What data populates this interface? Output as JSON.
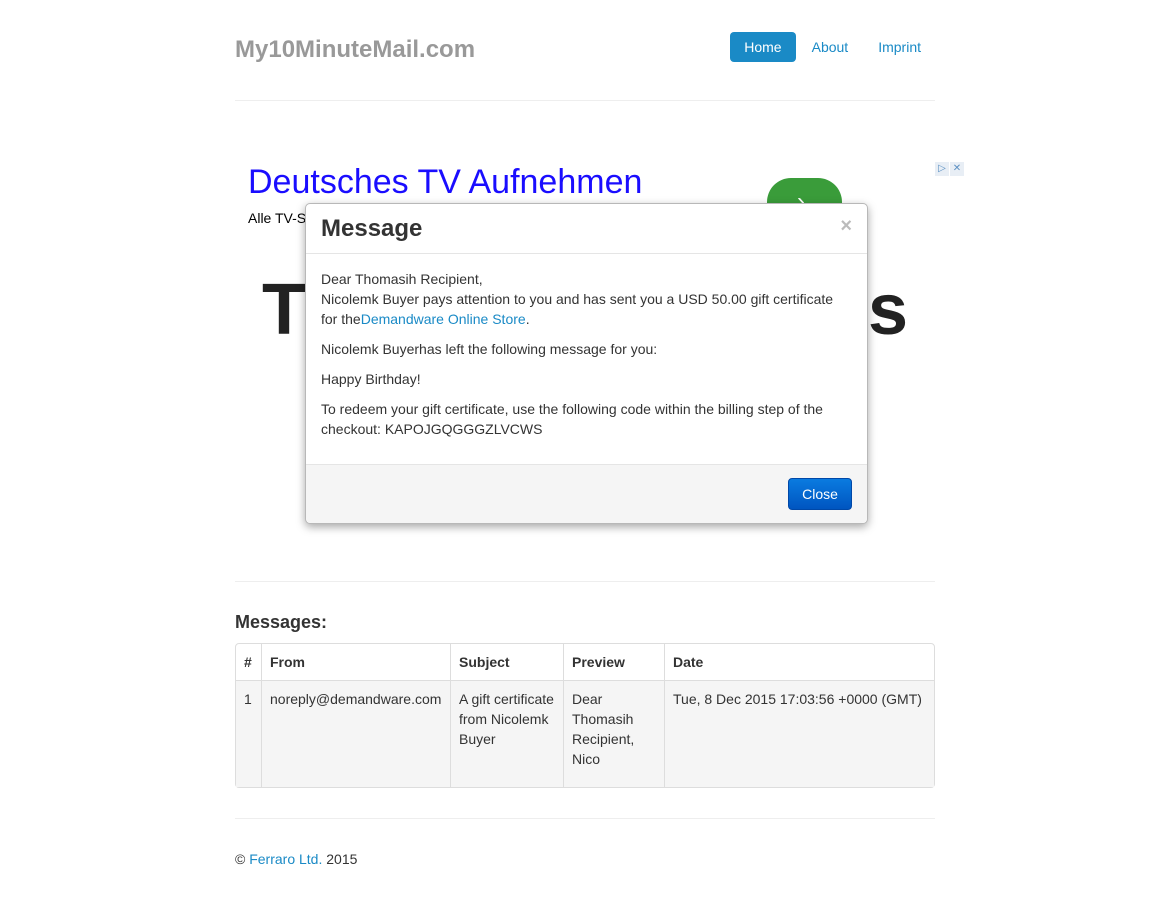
{
  "header": {
    "brand": "My10MinuteMail.com",
    "nav": [
      {
        "label": "Home",
        "active": true
      },
      {
        "label": "About",
        "active": false
      },
      {
        "label": "Imprint",
        "active": false
      }
    ]
  },
  "ad": {
    "title": "Deutsches TV Aufnehmen",
    "subtitle": "Alle TV-S",
    "big_left": "T",
    "big_right": "s",
    "button_icon": "chevron-right-icon",
    "corner_icons": [
      "adchoices-icon",
      "close-icon"
    ]
  },
  "modal": {
    "title": "Message",
    "close_x": "×",
    "greeting": "Dear Thomasih Recipient,",
    "line1": "Nicolemk Buyer pays attention to you and has sent you a USD 50.00 gift certificate",
    "line2_prefix": "for the",
    "store_link": "Demandware Online Store",
    "line2_suffix": ".",
    "line3": "Nicolemk Buyerhas left the following message for you:",
    "line4": "Happy Birthday!",
    "line5": "To redeem your gift certificate, use the following code within the billing step of the checkout: KAPOJGQGGGZLVCWS",
    "close_button": "Close"
  },
  "messages": {
    "heading": "Messages:",
    "columns": [
      "#",
      "From",
      "Subject",
      "Preview",
      "Date"
    ],
    "rows": [
      {
        "num": "1",
        "from": "noreply@demandware.com",
        "subject": "A gift certificate from Nicolemk Buyer",
        "preview": "Dear Thomasih Recipient, Nico",
        "date": "Tue, 8 Dec 2015 17:03:56 +0000 (GMT)"
      }
    ]
  },
  "footer": {
    "copyright": "©",
    "company": "Ferraro Ltd.",
    "year": "2015"
  },
  "colors": {
    "accent": "#1a8ac6",
    "brand_gray": "#999999",
    "ad_title": "#1a0dff",
    "ad_button": "#3a9c3a"
  }
}
